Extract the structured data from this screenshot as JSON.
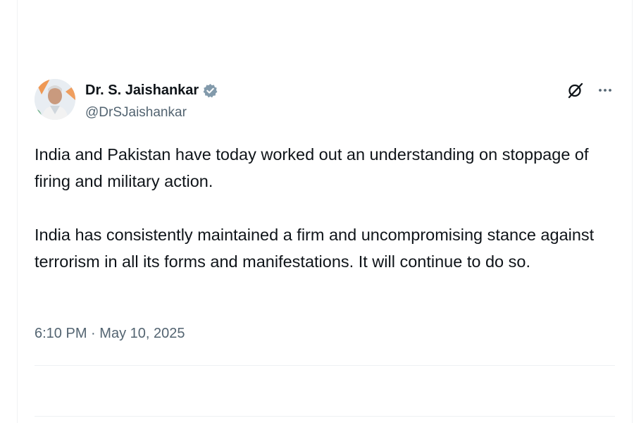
{
  "tweet": {
    "author": {
      "display_name": "Dr. S. Jaishankar",
      "handle": "@DrSJaishankar",
      "verified_icon": "verified-badge-icon"
    },
    "paragraphs": [
      "India and Pakistan have today worked out an understanding on stoppage of firing and military action.",
      "India has consistently maintained a firm and uncompromising stance against terrorism in all its forms and manifestations. It will continue to do so."
    ],
    "time": "6:10 PM",
    "separator": "·",
    "date": "May 10, 2025"
  },
  "actions": {
    "grok_icon": "grok-icon",
    "more_icon": "more-options-icon"
  },
  "colors": {
    "text_primary": "#0f1419",
    "text_secondary": "#536471",
    "verified": "#829aab"
  }
}
